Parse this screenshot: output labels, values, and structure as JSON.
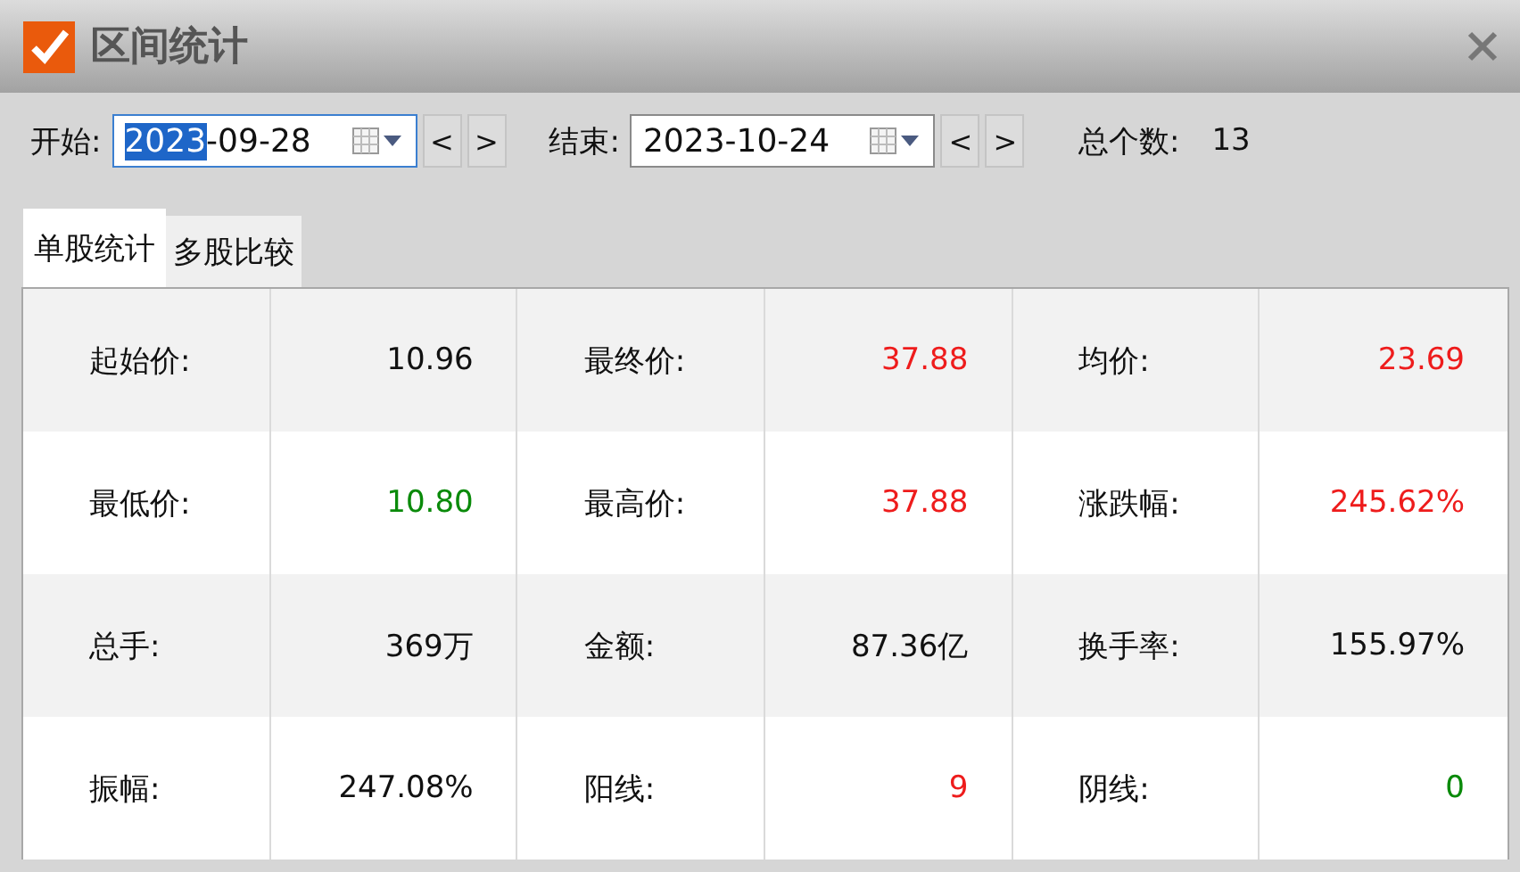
{
  "window": {
    "title": "区间统计"
  },
  "range": {
    "start_label": "开始:",
    "start": {
      "value_selected": "2023",
      "value_rest": "-09-28",
      "focused": true
    },
    "end_label": "结束:",
    "end": {
      "value_rest": "2023-10-24",
      "focused": false
    },
    "prev": "<",
    "next": ">",
    "count_label": "总个数:",
    "count": "13"
  },
  "tabs": [
    {
      "label": "单股统计",
      "selected": true
    },
    {
      "label": "多股比较",
      "selected": false
    }
  ],
  "stats": [
    {
      "label": "起始价:",
      "value": "10.96",
      "color": "#111111"
    },
    {
      "label": "最终价:",
      "value": "37.88",
      "color": "#ee1c1c"
    },
    {
      "label": "均价:",
      "value": "23.69",
      "color": "#ee1c1c"
    },
    {
      "label": "最低价:",
      "value": "10.80",
      "color": "#0a8a0a"
    },
    {
      "label": "最高价:",
      "value": "37.88",
      "color": "#ee1c1c"
    },
    {
      "label": "涨跌幅:",
      "value": "245.62%",
      "color": "#ee1c1c"
    },
    {
      "label": "总手:",
      "value": "369万",
      "color": "#111111"
    },
    {
      "label": "金额:",
      "value": "87.36亿",
      "color": "#111111"
    },
    {
      "label": "换手率:",
      "value": "155.97%",
      "color": "#111111"
    },
    {
      "label": "振幅:",
      "value": "247.08%",
      "color": "#111111"
    },
    {
      "label": "阳线:",
      "value": "9",
      "color": "#ee1c1c"
    },
    {
      "label": "阴线:",
      "value": "0",
      "color": "#0a8a0a"
    }
  ]
}
